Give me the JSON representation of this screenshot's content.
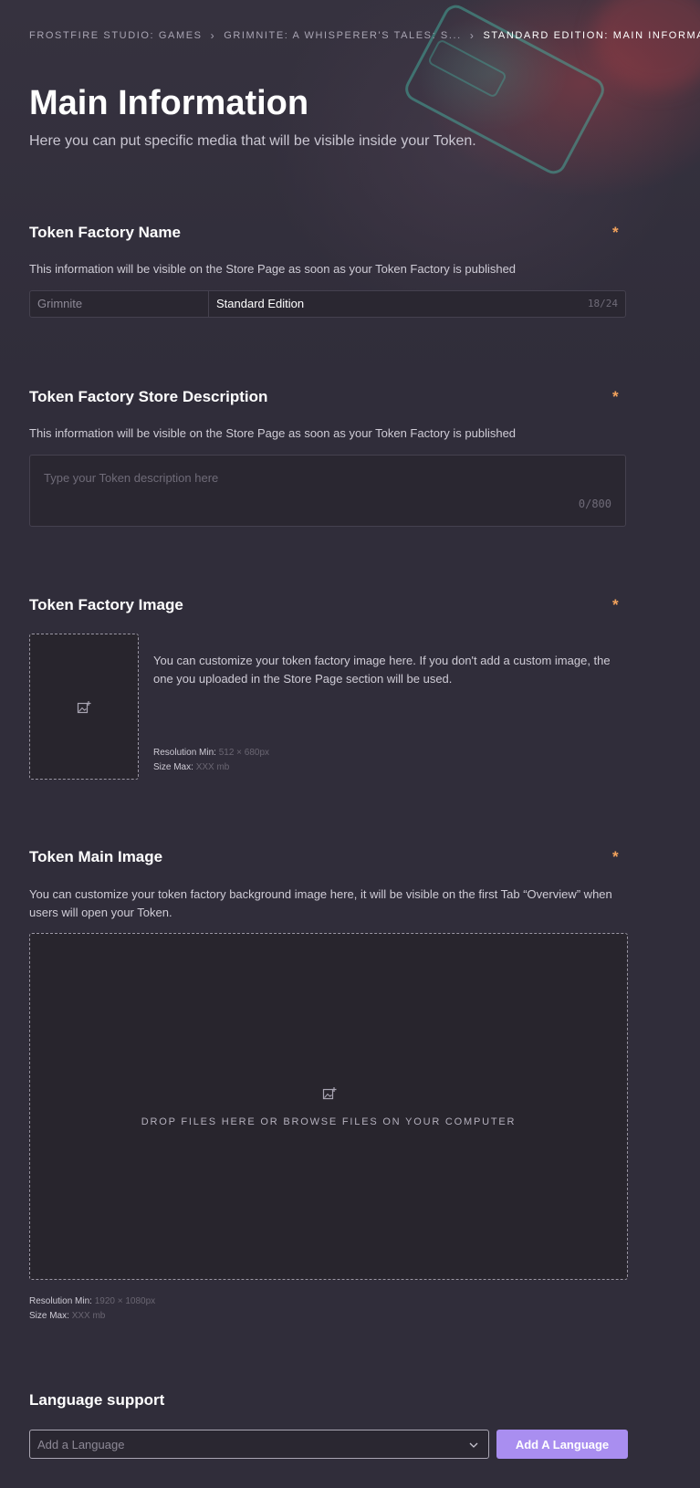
{
  "breadcrumb": {
    "items": [
      "FROSTFIRE STUDIO: GAMES",
      "GRIMNITE: A WHISPERER'S TALES: S...",
      "STANDARD EDITION: MAIN INFORMATION"
    ]
  },
  "header": {
    "title": "Main Information",
    "subtitle": "Here you can put specific media that will be visible inside your Token."
  },
  "token_name": {
    "title": "Token Factory Name",
    "required": "*",
    "description": "This information will be visible on the Store Page as soon as your Token Factory is published",
    "prefix": "Grimnite",
    "value": "Standard Edition",
    "counter": "18/24"
  },
  "store_description": {
    "title": "Token Factory Store Description",
    "required": "*",
    "description": "This information will be visible on the Store Page as soon as your Token Factory is published",
    "placeholder": "Type your Token description here",
    "counter": "0/800"
  },
  "factory_image": {
    "title": "Token Factory Image",
    "required": "*",
    "description": "You can customize your token factory image here. If you don't add a custom image, the one you uploaded in the Store Page section will be used.",
    "resolution_label": "Resolution Min:",
    "resolution_value": "512 × 680px",
    "size_label": "Size Max:",
    "size_value": "XXX mb",
    "icon": "add-image-icon"
  },
  "main_image": {
    "title": "Token Main Image",
    "required": "*",
    "description": "You can customize your token factory background image here, it will be visible on the first Tab “Overview” when users will open your Token.",
    "drop_text": "DROP FILES HERE OR BROWSE FILES ON YOUR COMPUTER",
    "resolution_label": "Resolution Min:",
    "resolution_value": "1920 × 1080px",
    "size_label": "Size Max:",
    "size_value": "XXX mb",
    "icon": "add-image-icon"
  },
  "language": {
    "title": "Language support",
    "placeholder": "Add a Language",
    "button_label": "Add A Language",
    "button_color": "#a98ef0"
  },
  "colors": {
    "background": "#302d3a",
    "required": "#f2a25c",
    "accent": "#a98ef0"
  }
}
